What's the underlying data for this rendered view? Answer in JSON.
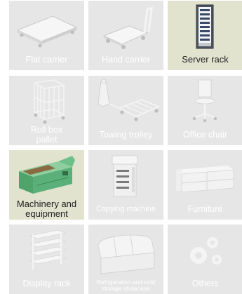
{
  "categories": [
    {
      "label": "Flat carrier",
      "icon": "flat-carrier-icon"
    },
    {
      "label": "Hand carrier",
      "icon": "hand-carrier-icon"
    },
    {
      "label": "Server rack",
      "icon": "server-rack-icon"
    },
    {
      "label": "Roll box pallet",
      "icon": "roll-box-pallet-icon"
    },
    {
      "label": "Towing trolley",
      "icon": "towing-trolley-icon"
    },
    {
      "label": "Office chair",
      "icon": "office-chair-icon"
    },
    {
      "label": "Machinery and equipment",
      "icon": "machinery-icon"
    },
    {
      "label": "Copying machine",
      "icon": "copying-machine-icon"
    },
    {
      "label": "Furniture",
      "icon": "furniture-icon"
    },
    {
      "label": "Display rack",
      "icon": "display-rack-icon"
    },
    {
      "label": "Refrigeration and cold storage showcase",
      "icon": "refrigeration-showcase-icon"
    },
    {
      "label": "Others",
      "icon": "gears-icon"
    }
  ],
  "colors": {
    "tile_bg": "#e6e6e6",
    "tile_active_bg": "#e2e3cf",
    "label_color": "#ffffff",
    "active_label_color": "#222222",
    "machine_green": "#5bb07a"
  }
}
